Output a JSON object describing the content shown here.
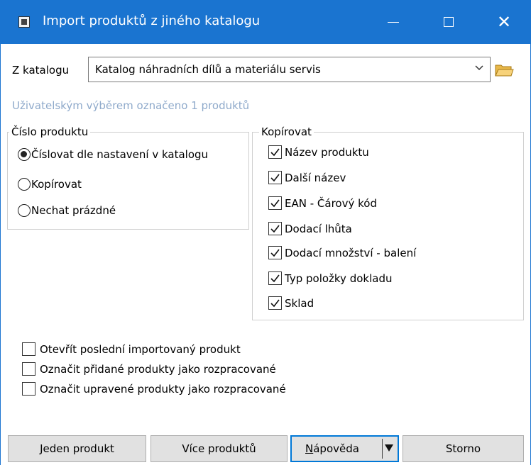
{
  "window": {
    "title": "Import produktů z jiného katalogu",
    "controls": {
      "minimize": "minimize-icon",
      "maximize": "maximize-icon",
      "close": "close-icon"
    }
  },
  "source": {
    "label": "Z katalogu",
    "value": "Katalog náhradních dílů a materiálu servis"
  },
  "info_text": "Uživatelským výběrem označeno 1 produktů",
  "number_group": {
    "title": "Číslo produktu",
    "options": [
      {
        "label": "Číslovat dle nastavení v katalogu",
        "selected": true
      },
      {
        "label": "Kopírovat",
        "selected": false
      },
      {
        "label": "Nechat prázdné",
        "selected": false
      }
    ]
  },
  "copy_group": {
    "title": "Kopírovat",
    "items": [
      {
        "label": "Název produktu",
        "checked": true
      },
      {
        "label": "Další název",
        "checked": true
      },
      {
        "label": "EAN - Čárový kód",
        "checked": true
      },
      {
        "label": "Dodací lhůta",
        "checked": true
      },
      {
        "label": "Dodací množství - balení",
        "checked": true
      },
      {
        "label": "Typ položky dokladu",
        "checked": true
      },
      {
        "label": "Sklad",
        "checked": true
      }
    ]
  },
  "options": [
    {
      "label": "Otevřít poslední importovaný produkt",
      "checked": false
    },
    {
      "label": "Označit přidané produkty jako rozpracované",
      "checked": false
    },
    {
      "label": "Označit upravené produkty jako rozpracované",
      "checked": false
    }
  ],
  "buttons": {
    "single": "Jeden produkt",
    "multi": "Více produktů",
    "help_first": "N",
    "help_rest": "ápověda",
    "cancel": "Storno"
  },
  "colors": {
    "titlebar": "#1a74d0",
    "info_text": "#8faacb",
    "default_button_border": "#0078d7"
  }
}
